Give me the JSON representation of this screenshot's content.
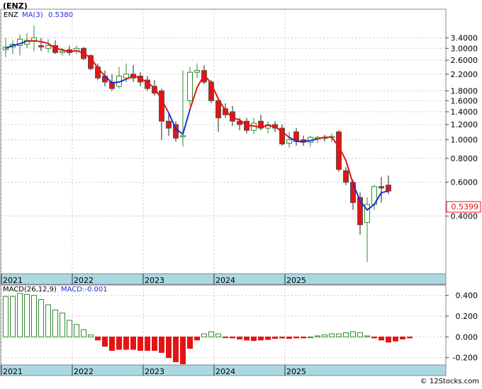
{
  "header": {
    "symbol": "(ENZ)",
    "price_legend": "ENZ",
    "ma_legend": "MA(3)",
    "ma_value": "0.5380",
    "macd_legend": "MACD(26,12,9)",
    "macd_value_legend": "MACD:-0.001",
    "last_price_badge": "0.5399",
    "credit": "© 12Stocks.com"
  },
  "colors": {
    "up": "#2e8b2e",
    "down": "#e51414",
    "ma_red": "#e51414",
    "ma_blue": "#1f2fd6",
    "axis_strip": "#a9d8e2",
    "grid": "#c8c8c8"
  },
  "chart_data": [
    {
      "type": "candlestick",
      "name": "price",
      "scale": "log",
      "ylim": [
        0.2,
        4.8
      ],
      "yticks": [
        3.4,
        3.0,
        2.6,
        2.2,
        1.8,
        1.6,
        1.4,
        1.2,
        1.0,
        0.8,
        0.6,
        0.4
      ],
      "ytick_labels": [
        "3.4000",
        "3.0000",
        "2.6000",
        "2.2000",
        "1.8000",
        "1.6000",
        "1.4000",
        "1.2000",
        "1.0000",
        "0.8000",
        "0.6000",
        "0.4000"
      ],
      "xticks": [
        0,
        10,
        20,
        30,
        40
      ],
      "xtick_labels": [
        "2021",
        "2022",
        "2023",
        "2024",
        "2025"
      ],
      "last_value": 0.5399,
      "candles": [
        {
          "o": 2.95,
          "h": 3.4,
          "l": 2.7,
          "c": 3.05
        },
        {
          "o": 3.05,
          "h": 3.3,
          "l": 2.8,
          "c": 3.15
        },
        {
          "o": 3.1,
          "h": 3.55,
          "l": 2.75,
          "c": 3.35
        },
        {
          "o": 3.15,
          "h": 3.6,
          "l": 3.0,
          "c": 3.3
        },
        {
          "o": 3.3,
          "h": 3.95,
          "l": 2.9,
          "c": 3.4
        },
        {
          "o": 3.1,
          "h": 3.4,
          "l": 2.9,
          "c": 3.05
        },
        {
          "o": 3.0,
          "h": 3.35,
          "l": 2.85,
          "c": 3.1
        },
        {
          "o": 3.1,
          "h": 3.3,
          "l": 2.8,
          "c": 2.85
        },
        {
          "o": 2.85,
          "h": 3.0,
          "l": 2.75,
          "c": 2.9
        },
        {
          "o": 2.95,
          "h": 3.1,
          "l": 2.75,
          "c": 2.85
        },
        {
          "o": 2.9,
          "h": 3.1,
          "l": 2.8,
          "c": 3.0
        },
        {
          "o": 3.0,
          "h": 3.05,
          "l": 2.6,
          "c": 2.65
        },
        {
          "o": 2.75,
          "h": 2.8,
          "l": 2.3,
          "c": 2.35
        },
        {
          "o": 2.4,
          "h": 2.5,
          "l": 2.05,
          "c": 2.1
        },
        {
          "o": 2.15,
          "h": 2.3,
          "l": 1.9,
          "c": 2.0
        },
        {
          "o": 2.0,
          "h": 2.2,
          "l": 1.8,
          "c": 1.85
        },
        {
          "o": 1.9,
          "h": 2.4,
          "l": 1.85,
          "c": 2.15
        },
        {
          "o": 2.1,
          "h": 2.5,
          "l": 2.0,
          "c": 2.2
        },
        {
          "o": 2.2,
          "h": 2.45,
          "l": 2.0,
          "c": 2.1
        },
        {
          "o": 2.15,
          "h": 2.25,
          "l": 1.9,
          "c": 2.0
        },
        {
          "o": 2.05,
          "h": 2.15,
          "l": 1.8,
          "c": 1.85
        },
        {
          "o": 1.9,
          "h": 2.05,
          "l": 1.7,
          "c": 1.75
        },
        {
          "o": 1.8,
          "h": 1.85,
          "l": 1.0,
          "c": 1.25
        },
        {
          "o": 1.25,
          "h": 1.35,
          "l": 1.05,
          "c": 1.15
        },
        {
          "o": 1.2,
          "h": 1.25,
          "l": 0.98,
          "c": 1.02
        },
        {
          "o": 1.05,
          "h": 2.3,
          "l": 0.92,
          "c": 1.05
        },
        {
          "o": 1.6,
          "h": 2.4,
          "l": 1.5,
          "c": 2.25
        },
        {
          "o": 2.25,
          "h": 2.5,
          "l": 2.1,
          "c": 2.3
        },
        {
          "o": 2.3,
          "h": 2.45,
          "l": 1.95,
          "c": 2.0
        },
        {
          "o": 2.0,
          "h": 2.05,
          "l": 1.55,
          "c": 1.6
        },
        {
          "o": 1.6,
          "h": 1.65,
          "l": 1.1,
          "c": 1.3
        },
        {
          "o": 1.45,
          "h": 1.55,
          "l": 1.3,
          "c": 1.35
        },
        {
          "o": 1.4,
          "h": 1.5,
          "l": 1.18,
          "c": 1.25
        },
        {
          "o": 1.25,
          "h": 1.3,
          "l": 1.12,
          "c": 1.2
        },
        {
          "o": 1.25,
          "h": 1.3,
          "l": 1.08,
          "c": 1.12
        },
        {
          "o": 1.12,
          "h": 1.3,
          "l": 1.07,
          "c": 1.22
        },
        {
          "o": 1.25,
          "h": 1.35,
          "l": 1.12,
          "c": 1.15
        },
        {
          "o": 1.15,
          "h": 1.25,
          "l": 1.08,
          "c": 1.2
        },
        {
          "o": 1.2,
          "h": 1.25,
          "l": 1.1,
          "c": 1.15
        },
        {
          "o": 1.15,
          "h": 1.2,
          "l": 0.93,
          "c": 0.95
        },
        {
          "o": 0.96,
          "h": 1.1,
          "l": 0.91,
          "c": 1.0
        },
        {
          "o": 1.1,
          "h": 1.15,
          "l": 0.93,
          "c": 0.98
        },
        {
          "o": 1.0,
          "h": 1.05,
          "l": 0.93,
          "c": 0.97
        },
        {
          "o": 0.97,
          "h": 1.05,
          "l": 0.92,
          "c": 1.03
        },
        {
          "o": 1.02,
          "h": 1.05,
          "l": 0.96,
          "c": 1.03
        },
        {
          "o": 1.03,
          "h": 1.06,
          "l": 0.98,
          "c": 1.02
        },
        {
          "o": 1.03,
          "h": 1.08,
          "l": 0.97,
          "c": 1.04
        },
        {
          "o": 1.1,
          "h": 1.12,
          "l": 0.68,
          "c": 0.7
        },
        {
          "o": 0.69,
          "h": 0.72,
          "l": 0.58,
          "c": 0.6
        },
        {
          "o": 0.6,
          "h": 0.62,
          "l": 0.43,
          "c": 0.47
        },
        {
          "o": 0.5,
          "h": 0.53,
          "l": 0.32,
          "c": 0.36
        },
        {
          "o": 0.37,
          "h": 0.5,
          "l": 0.23,
          "c": 0.46
        },
        {
          "o": 0.46,
          "h": 0.58,
          "l": 0.43,
          "c": 0.57
        },
        {
          "o": 0.57,
          "h": 0.64,
          "l": 0.47,
          "c": 0.56
        },
        {
          "o": 0.58,
          "h": 0.65,
          "l": 0.52,
          "c": 0.54
        }
      ],
      "ma": [
        3.0,
        3.1,
        3.17,
        3.27,
        3.28,
        3.25,
        3.18,
        3.0,
        2.95,
        2.87,
        2.92,
        2.83,
        2.67,
        2.37,
        2.15,
        1.98,
        2.0,
        2.07,
        2.15,
        2.1,
        1.98,
        1.87,
        1.62,
        1.38,
        1.14,
        1.07,
        1.44,
        1.87,
        2.18,
        1.97,
        1.63,
        1.42,
        1.3,
        1.27,
        1.19,
        1.18,
        1.16,
        1.19,
        1.17,
        1.1,
        1.03,
        0.98,
        0.98,
        0.99,
        1.01,
        1.03,
        1.03,
        0.92,
        0.78,
        0.59,
        0.48,
        0.43,
        0.46,
        0.53,
        0.54
      ],
      "ma_trend_color": [
        "blue",
        "blue",
        "blue",
        "blue",
        "red",
        "red",
        "red",
        "red",
        "red",
        "red",
        "red",
        "red",
        "red",
        "red",
        "red",
        "blue",
        "blue",
        "blue",
        "red",
        "red",
        "red",
        "red",
        "red",
        "red",
        "blue",
        "blue",
        "blue",
        "red",
        "red",
        "red",
        "red",
        "red",
        "red",
        "red",
        "red",
        "red",
        "red",
        "red",
        "red",
        "red",
        "red",
        "blue",
        "blue",
        "blue",
        "blue",
        "red",
        "red",
        "red",
        "red",
        "red",
        "blue",
        "blue",
        "blue",
        "blue",
        "blue"
      ]
    },
    {
      "type": "bar",
      "name": "macd_histogram",
      "ylim": [
        -0.27,
        0.5
      ],
      "yticks": [
        0.4,
        0.2,
        0.0,
        -0.2
      ],
      "ytick_labels": [
        "0.400",
        "0.200",
        "0.000",
        "-0.200"
      ],
      "xticks": [
        0,
        10,
        20,
        30,
        40
      ],
      "xtick_labels": [
        "2021",
        "2022",
        "2023",
        "2024",
        "2025"
      ],
      "values": [
        0.39,
        0.39,
        0.42,
        0.41,
        0.4,
        0.36,
        0.31,
        0.26,
        0.23,
        0.16,
        0.12,
        0.07,
        0.02,
        -0.03,
        -0.09,
        -0.13,
        -0.12,
        -0.12,
        -0.12,
        -0.13,
        -0.13,
        -0.13,
        -0.15,
        -0.2,
        -0.24,
        -0.26,
        -0.11,
        -0.03,
        0.03,
        0.05,
        0.03,
        -0.005,
        -0.01,
        -0.02,
        -0.03,
        -0.035,
        -0.03,
        -0.025,
        -0.015,
        -0.01,
        -0.015,
        -0.01,
        -0.01,
        0.0,
        0.01,
        0.02,
        0.03,
        0.03,
        0.04,
        0.05,
        0.04,
        0.01,
        -0.01,
        -0.03,
        -0.05,
        -0.04,
        -0.02,
        -0.01
      ]
    }
  ]
}
